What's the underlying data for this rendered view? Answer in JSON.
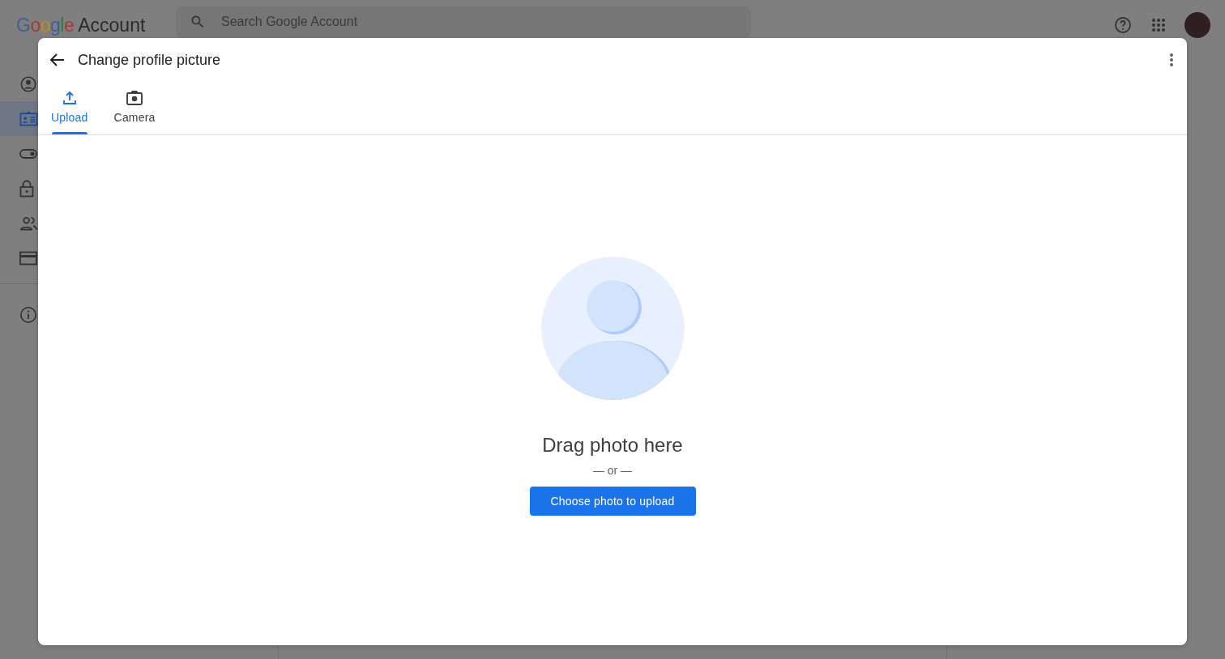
{
  "header": {
    "logo": {
      "brand": "Google",
      "product": "Account"
    },
    "search": {
      "placeholder": "Search Google Account"
    }
  },
  "sidebar": {
    "items": [
      {
        "kind": "person",
        "selected": false
      },
      {
        "kind": "id-card",
        "selected": true
      },
      {
        "kind": "toggle",
        "selected": false
      },
      {
        "kind": "lock",
        "selected": false
      },
      {
        "kind": "people",
        "selected": false
      },
      {
        "kind": "card",
        "selected": false
      },
      {
        "kind": "info",
        "selected": false
      }
    ]
  },
  "dialog": {
    "title": "Change profile picture",
    "tabs": [
      {
        "label": "Upload",
        "kind": "upload",
        "selected": true
      },
      {
        "label": "Camera",
        "kind": "camera",
        "selected": false
      }
    ],
    "prompt": "Drag photo here",
    "separator": "— or —",
    "button": "Choose photo to upload"
  }
}
